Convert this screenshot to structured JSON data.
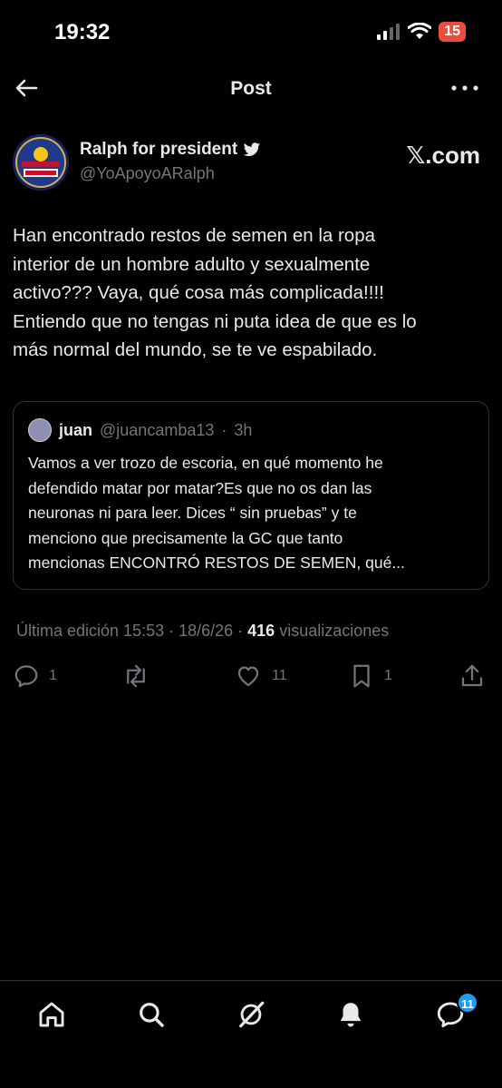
{
  "status_bar": {
    "time": "19:32",
    "battery": "15"
  },
  "header": {
    "title": "Post"
  },
  "author": {
    "name": "Ralph for president",
    "handle": "@YoApoyoARalph",
    "avatar_text_top": "VOTE RALPH",
    "avatar_text_bottom": "PRESIDENT",
    "source": "𝕏.com"
  },
  "post": {
    "lines": [
      "Han encontrado restos de semen en la ropa",
      "interior de un hombre adulto y sexualmente",
      "activo??? Vaya, qué cosa más complicada!!!!",
      "Entiendo que no tengas ni puta idea de que es lo",
      "más normal del mundo, se te ve espabilado."
    ]
  },
  "quote": {
    "name": "juan",
    "handle": "@juancamba13",
    "separator": "·",
    "time": "3h",
    "lines": [
      "Vamos a ver trozo de escoria, en qué momento he",
      "defendido matar por matar?Es que no os dan las",
      "neuronas ni para leer. Dices “ sin pruebas” y te",
      "menciono que precisamente la GC que tanto",
      "mencionas ENCONTRÓ RESTOS DE SEMEN, qué..."
    ]
  },
  "meta": {
    "edited": "Última edición 15:53 · 18/6/26 · ",
    "views_count": "416",
    "views_label": " visualizaciones"
  },
  "actions": {
    "replies": "1",
    "reposts": "",
    "likes": "11",
    "bookmarks": "1"
  },
  "bottom_nav": {
    "messages_badge": "11"
  },
  "colors": {
    "accent": "#1d9bf0",
    "muted": "#71767b",
    "text": "#e7e9ea",
    "battery": "#eb4d3d"
  }
}
